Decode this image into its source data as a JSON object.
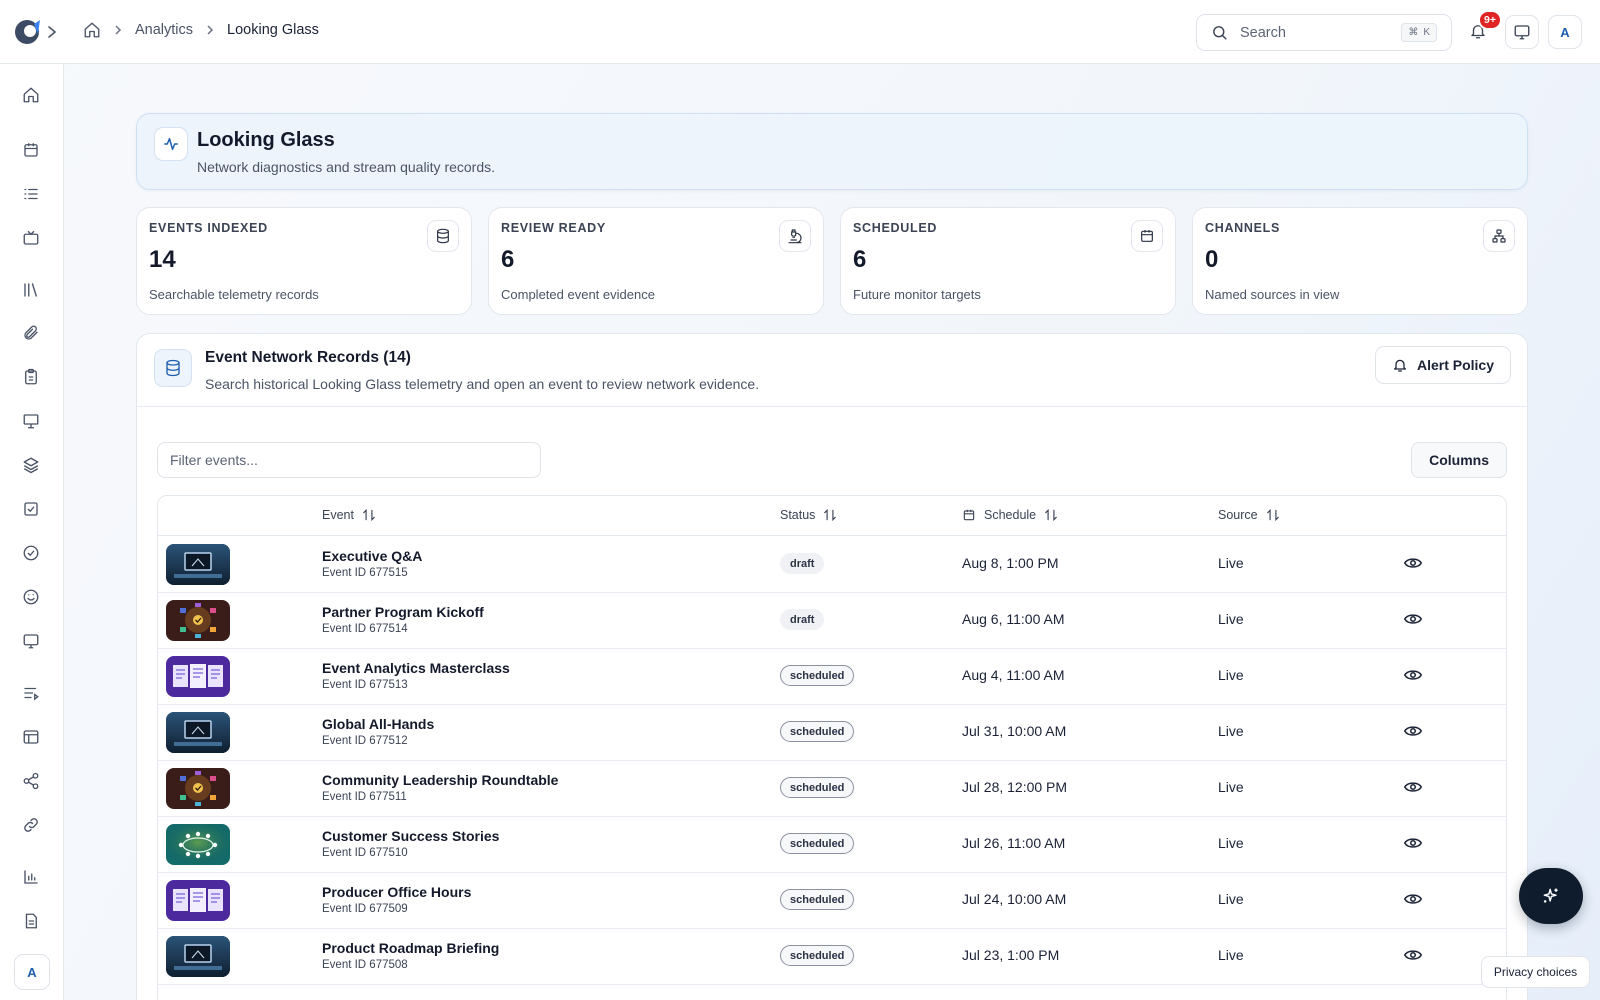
{
  "breadcrumb": {
    "section": "Analytics",
    "current": "Looking Glass"
  },
  "search": {
    "placeholder": "Search",
    "shortcut_key": "K"
  },
  "notifications": {
    "badge": "9+"
  },
  "user": {
    "initial": "A"
  },
  "header": {
    "title": "Looking Glass",
    "subtitle": "Network diagnostics and stream quality records."
  },
  "stats": [
    {
      "label": "EVENTS INDEXED",
      "value": "14",
      "sub": "Searchable telemetry records",
      "icon": "database-icon"
    },
    {
      "label": "REVIEW READY",
      "value": "6",
      "sub": "Completed event evidence",
      "icon": "microscope-icon"
    },
    {
      "label": "SCHEDULED",
      "value": "6",
      "sub": "Future monitor targets",
      "icon": "calendar-icon"
    },
    {
      "label": "CHANNELS",
      "value": "0",
      "sub": "Named sources in view",
      "icon": "network-icon"
    }
  ],
  "records": {
    "title": "Event Network Records (14)",
    "subtitle": "Search historical Looking Glass telemetry and open an event to review network evidence.",
    "alert_button": "Alert Policy",
    "filter_placeholder": "Filter events...",
    "columns_button": "Columns",
    "headers": {
      "event": "Event",
      "status": "Status",
      "schedule": "Schedule",
      "source": "Source"
    },
    "rows": [
      {
        "name": "Executive Q&A",
        "id": "Event ID 677515",
        "status": "draft",
        "schedule": "Aug 8, 1:00 PM",
        "source": "Live",
        "thumb": "monitor"
      },
      {
        "name": "Partner Program Kickoff",
        "id": "Event ID 677514",
        "status": "draft",
        "schedule": "Aug 6, 11:00 AM",
        "source": "Live",
        "thumb": "hub"
      },
      {
        "name": "Event Analytics Masterclass",
        "id": "Event ID 677513",
        "status": "scheduled",
        "schedule": "Aug 4, 11:00 AM",
        "source": "Live",
        "thumb": "docs"
      },
      {
        "name": "Global All-Hands",
        "id": "Event ID 677512",
        "status": "scheduled",
        "schedule": "Jul 31, 10:00 AM",
        "source": "Live",
        "thumb": "monitor"
      },
      {
        "name": "Community Leadership Roundtable",
        "id": "Event ID 677511",
        "status": "scheduled",
        "schedule": "Jul 28, 12:00 PM",
        "source": "Live",
        "thumb": "hub"
      },
      {
        "name": "Customer Success Stories",
        "id": "Event ID 677510",
        "status": "scheduled",
        "schedule": "Jul 26, 11:00 AM",
        "source": "Live",
        "thumb": "table"
      },
      {
        "name": "Producer Office Hours",
        "id": "Event ID 677509",
        "status": "scheduled",
        "schedule": "Jul 24, 10:00 AM",
        "source": "Live",
        "thumb": "docs"
      },
      {
        "name": "Product Roadmap Briefing",
        "id": "Event ID 677508",
        "status": "scheduled",
        "schedule": "Jul 23, 1:00 PM",
        "source": "Live",
        "thumb": "monitor"
      }
    ]
  },
  "privacy": {
    "label": "Privacy choices"
  },
  "colors": {
    "accent": "#1e5fb0",
    "badge": "#e02424",
    "fab": "#0f1c2e"
  }
}
